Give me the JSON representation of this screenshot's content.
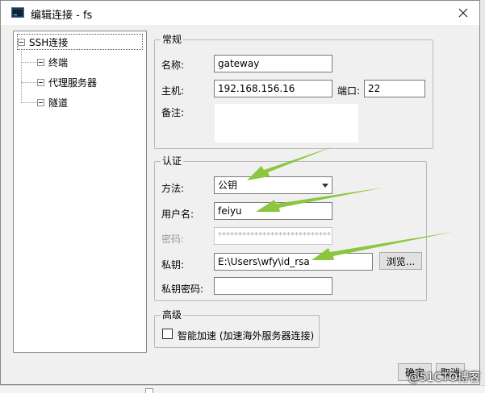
{
  "window": {
    "title": "编辑连接 - fs"
  },
  "tree": {
    "root": "SSH连接",
    "children": [
      "终端",
      "代理服务器",
      "隧道"
    ]
  },
  "general": {
    "title": "常规",
    "name_label": "名称:",
    "name_value": "gateway",
    "host_label": "主机:",
    "host_value": "192.168.156.16",
    "port_label": "端口:",
    "port_value": "22",
    "note_label": "备注:"
  },
  "auth": {
    "title": "认证",
    "method_label": "方法:",
    "method_value": "公钥",
    "user_label": "用户名:",
    "user_value": "feiyu",
    "password_label": "密码:",
    "password_value": "****************************",
    "key_label": "私钥:",
    "key_value": "E:\\Users\\wfy\\id_rsa",
    "browse_label": "浏览...",
    "key_pass_label": "私钥密码:"
  },
  "advanced": {
    "title": "高级",
    "accel_label": "智能加速 (加速海外服务器连接)"
  },
  "buttons": {
    "ok": "确定",
    "cancel": "取消"
  },
  "watermark": "@51CTO博客",
  "colors": {
    "arrow": "#8cc63f",
    "dialog_bg": "#f0f0f0"
  }
}
